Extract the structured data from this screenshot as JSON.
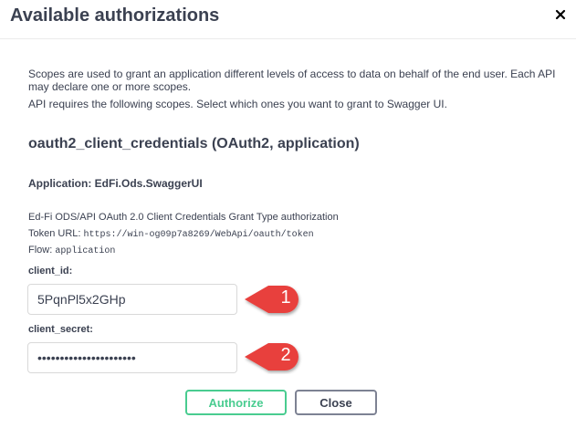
{
  "modal": {
    "title": "Available authorizations"
  },
  "intro": {
    "line1": "Scopes are used to grant an application different levels of access to data on behalf of the end user. Each API may declare one or more scopes.",
    "line2": "API requires the following scopes. Select which ones you want to grant to Swagger UI."
  },
  "scheme": {
    "title": "oauth2_client_credentials (OAuth2, application)",
    "application": "Application: EdFi.Ods.SwaggerUI",
    "description": "Ed-Fi ODS/API OAuth 2.0 Client Credentials Grant Type authorization",
    "token_url_label": "Token URL:",
    "token_url": "https://win-og09p7a8269/WebApi/oauth/token",
    "flow_label": "Flow:",
    "flow": "application"
  },
  "fields": {
    "client_id_label": "client_id:",
    "client_id_value": "5PqnPl5x2GHp",
    "client_secret_label": "client_secret:",
    "client_secret_value": "••••••••••••••••••••••"
  },
  "callouts": {
    "first": "1",
    "second": "2",
    "color": "#e8413e"
  },
  "buttons": {
    "authorize": "Authorize",
    "close": "Close"
  },
  "colors": {
    "authorize_green": "#49cc90",
    "text": "#3b4151"
  }
}
